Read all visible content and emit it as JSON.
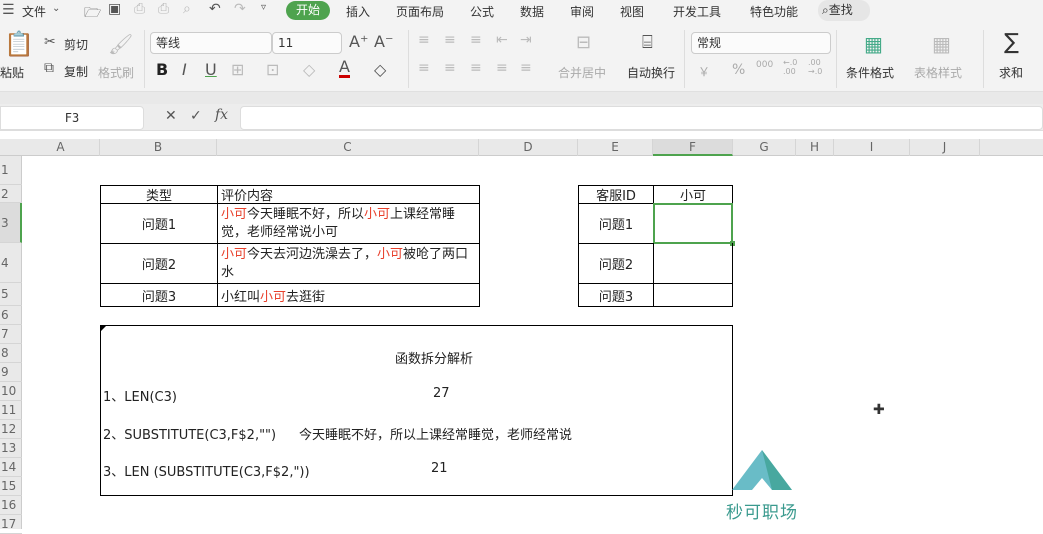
{
  "menu": {
    "file": "文件",
    "tabs": [
      "开始",
      "插入",
      "页面布局",
      "公式",
      "数据",
      "审阅",
      "视图",
      "开发工具",
      "特色功能"
    ],
    "search": "查找"
  },
  "ribbon": {
    "paste": "粘贴",
    "cut": "剪切",
    "copy": "复制",
    "format_painter": "格式刷",
    "font_name": "等线",
    "font_size": "11",
    "merge_center": "合并居中",
    "wrap_text": "自动换行",
    "number_format": "常规",
    "conditional_format": "条件格式",
    "table_style": "表格样式",
    "sum": "求和",
    "currency": "￥",
    "percent": "%",
    "thousands": "000",
    "inc_decimal": "←.0 .00",
    "dec_decimal": ".00 →.0"
  },
  "formula_bar": {
    "name_box": "F3",
    "value": ""
  },
  "columns": [
    "A",
    "B",
    "C",
    "D",
    "E",
    "F",
    "G",
    "H",
    "I",
    "J"
  ],
  "rows": [
    "1",
    "2",
    "3",
    "4",
    "5",
    "6",
    "7",
    "8",
    "9",
    "10",
    "11",
    "12",
    "13",
    "14",
    "15",
    "16",
    "17"
  ],
  "table1": {
    "headers": [
      "类型",
      "评价内容"
    ],
    "rows": [
      {
        "type": "问题1",
        "content": [
          [
            "小可",
            true
          ],
          [
            "今天睡眠不好，所以",
            false
          ],
          [
            "小可",
            true
          ],
          [
            "上课经常睡觉，老师经常说小可",
            false
          ]
        ]
      },
      {
        "type": "问题2",
        "content": [
          [
            "小可",
            true
          ],
          [
            "今天去河边洗澡去了，",
            false
          ],
          [
            "小可",
            true
          ],
          [
            "被呛了两口水",
            false
          ]
        ]
      },
      {
        "type": "问题3",
        "content": [
          [
            "小红叫",
            false
          ],
          [
            "小可",
            true
          ],
          [
            "去逛街",
            false
          ]
        ]
      }
    ]
  },
  "table2": {
    "headers": [
      "客服ID",
      "小可"
    ],
    "rows": [
      [
        "问题1",
        ""
      ],
      [
        "问题2",
        ""
      ],
      [
        "问题3",
        ""
      ]
    ]
  },
  "analysis": {
    "title": "函数拆分解析",
    "lines": [
      {
        "formula": "1、LEN(C3)",
        "result": "27"
      },
      {
        "formula": "2、SUBSTITUTE(C3,F$2,\"\")",
        "result": "今天睡眠不好，所以上课经常睡觉，老师经常说"
      },
      {
        "formula": "3、LEN (SUBSTITUTE(C3,F$2,\"))",
        "result": "21"
      }
    ]
  },
  "watermark": {
    "text": "秒可职场"
  },
  "colors": {
    "accent": "#4ea34e",
    "highlight_text": "#e8412c"
  }
}
